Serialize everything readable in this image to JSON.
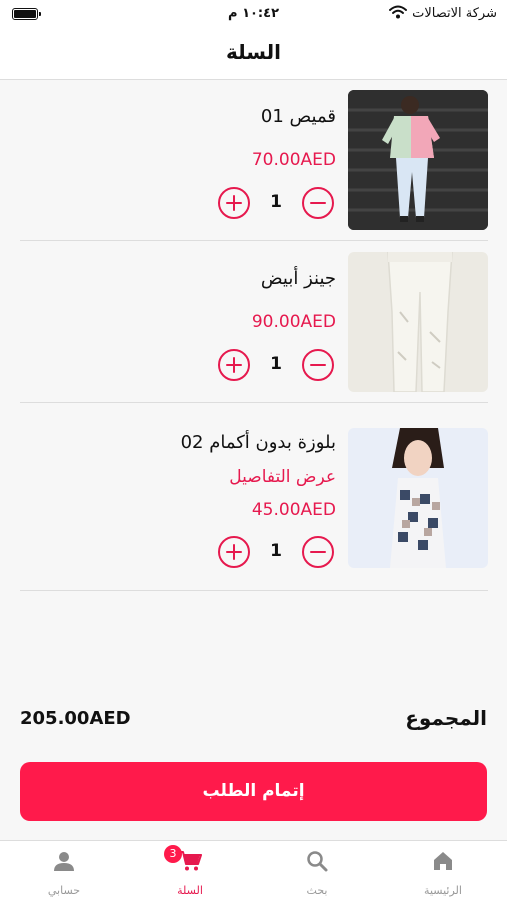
{
  "status_bar": {
    "carrier": "شركة الاتصالات",
    "time": "١٠:٤٢ م",
    "battery_level": 1.0
  },
  "header": {
    "title": "السلة"
  },
  "cart": {
    "items": [
      {
        "name": "قميص 01",
        "price": "70.00AED",
        "quantity": "1"
      },
      {
        "name": "جينز أبيض",
        "price": "90.00AED",
        "quantity": "1"
      },
      {
        "name": "بلوزة بدون أكمام 02",
        "details_link": "عرض التفاصيل",
        "price": "45.00AED",
        "quantity": "1"
      }
    ]
  },
  "summary": {
    "total_label": "المجموع",
    "total_value": "205.00AED"
  },
  "checkout": {
    "label": "إتمام الطلب"
  },
  "tab_bar": {
    "tabs": [
      {
        "label": "الرئيسية",
        "icon": "home-icon"
      },
      {
        "label": "بحث",
        "icon": "search-icon"
      },
      {
        "label": "السلة",
        "icon": "cart-icon",
        "badge": "3",
        "active": true
      },
      {
        "label": "حسابي",
        "icon": "user-icon"
      }
    ]
  },
  "colors": {
    "accent": "#ff1a4b",
    "price": "#e6194e",
    "muted": "#999999"
  }
}
